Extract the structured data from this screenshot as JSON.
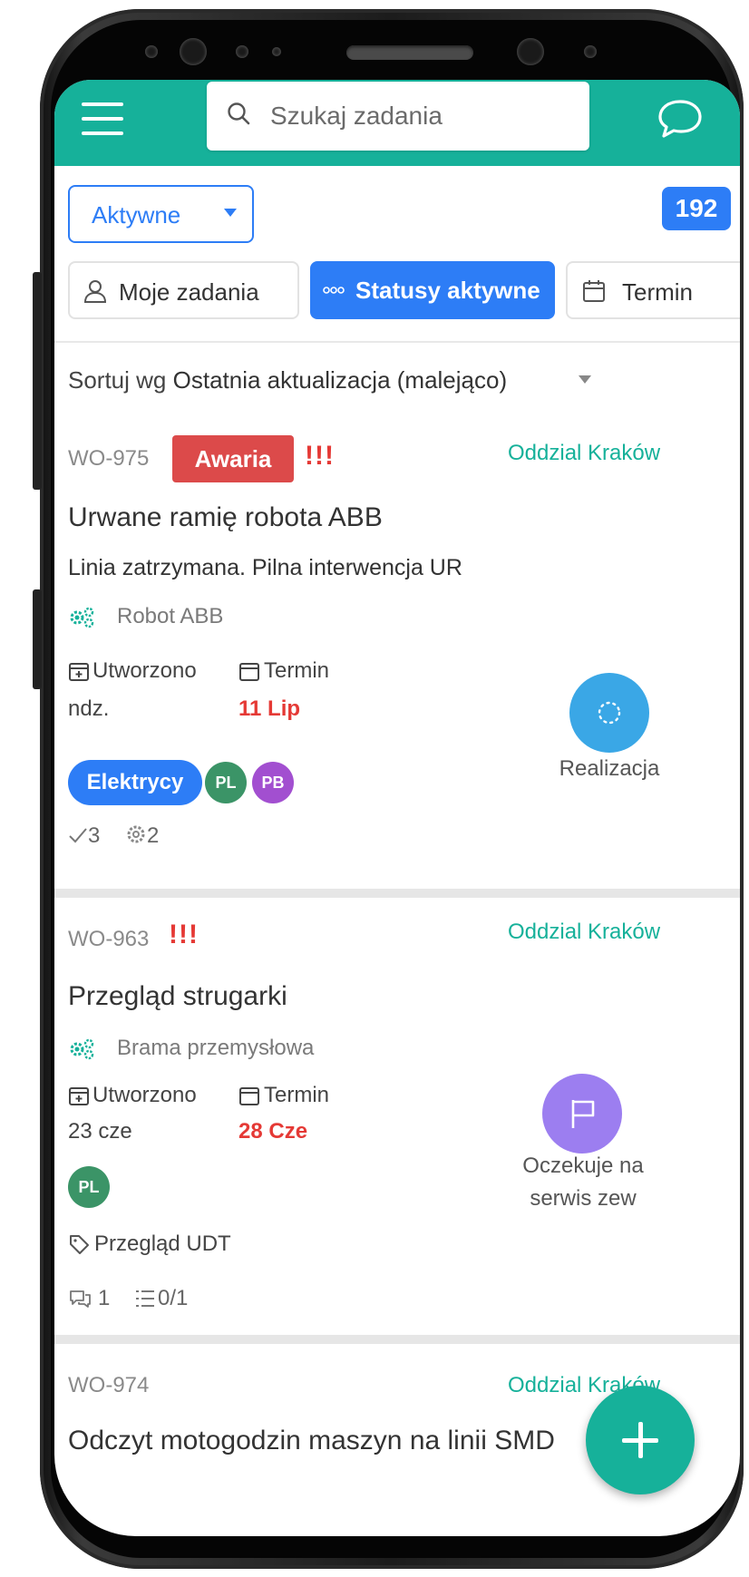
{
  "header": {
    "search_placeholder": "Szukaj zadania"
  },
  "filters": {
    "select_label": "Aktywne",
    "count": "192",
    "chips": {
      "my_tasks": "Moje zadania",
      "active_statuses": "Statusy aktywne",
      "deadline": "Termin"
    }
  },
  "sort": {
    "prefix": "Sortuj wg",
    "value": "Ostatnia aktualizacja (malejąco)"
  },
  "tasks": [
    {
      "id": "WO-975",
      "badge": "Awaria",
      "priority": "!!!",
      "branch": "Oddzial Kraków",
      "title": "Urwane ramię robota ABB",
      "description": "Linia zatrzymana. Pilna interwencja UR",
      "asset": "Robot ABB",
      "created_label": "Utworzono",
      "created_value": "ndz.",
      "due_label": "Termin",
      "due_value": "11 Lip",
      "team": "Elektrycy",
      "avatars": [
        "PL",
        "PB"
      ],
      "checks": "3",
      "parts": "2",
      "status": "Realizacja"
    },
    {
      "id": "WO-963",
      "priority": "!!!",
      "branch": "Oddzial Kraków",
      "title": "Przegląd strugarki",
      "asset": "Brama przemysłowa",
      "created_label": "Utworzono",
      "created_value": "23 cze",
      "due_label": "Termin",
      "due_value": "28 Cze",
      "avatars": [
        "PL"
      ],
      "tag": "Przegląd UDT",
      "comments": "1",
      "checklist": "0/1",
      "status_line1": "Oczekuje na",
      "status_line2": "serwis zew"
    },
    {
      "id": "WO-974",
      "branch": "Oddzial Kraków",
      "title": "Odczyt motogodzin maszyn na linii SMD"
    }
  ],
  "colors": {
    "header": "#16b19a",
    "primary_blue": "#2d7df6",
    "danger_red": "#dc4a4a",
    "status_realizacja": "#3aa7e6",
    "status_oczekuje": "#9c7ef0",
    "avatar_pl": "#3b9467",
    "avatar_pb": "#a24fd0"
  }
}
